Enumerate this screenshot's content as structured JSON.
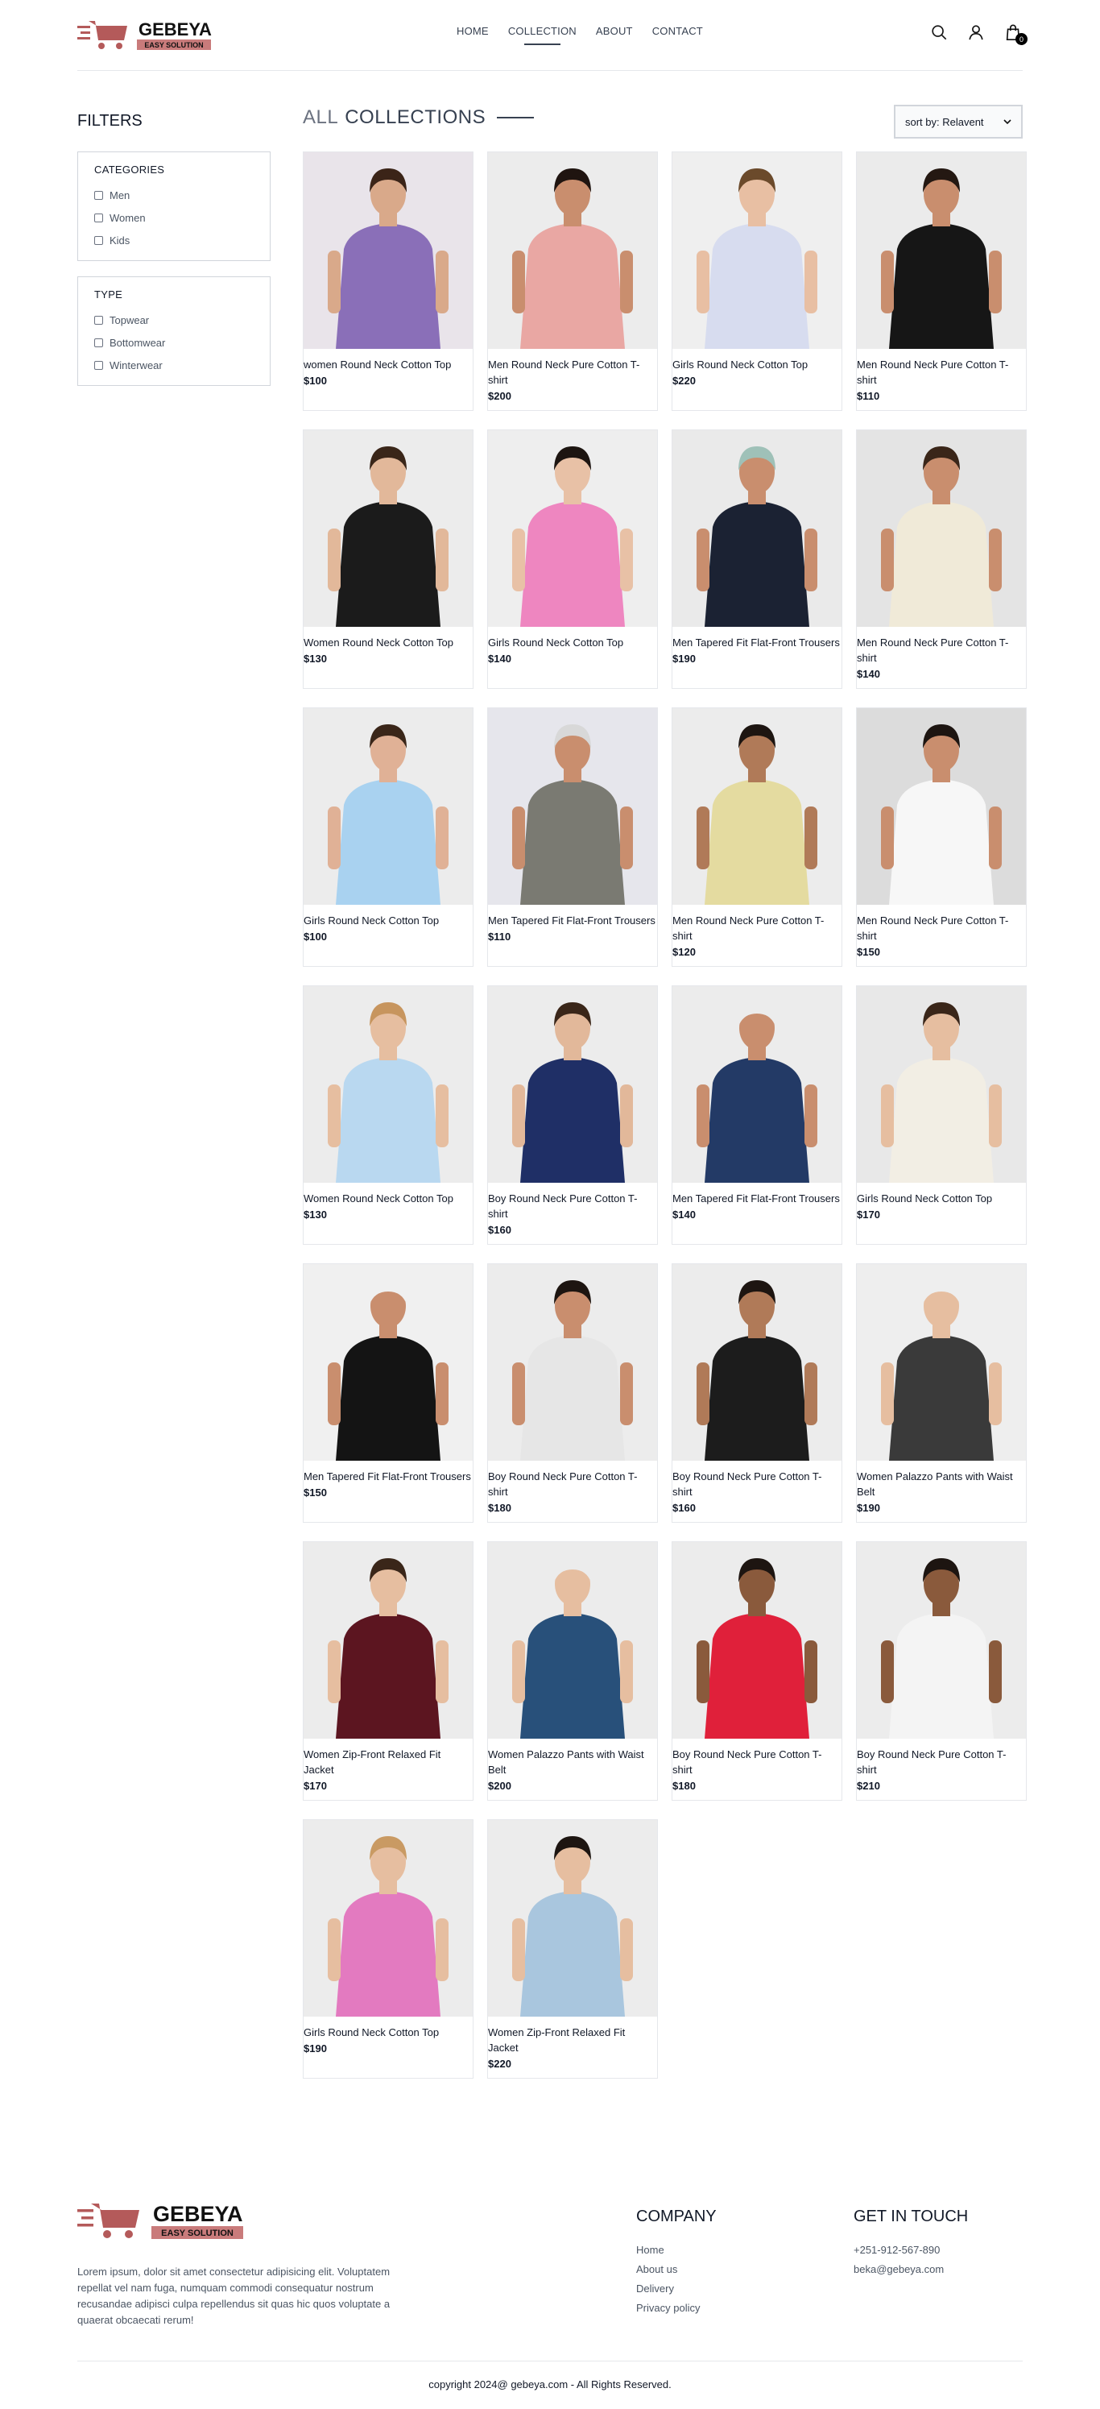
{
  "brand": {
    "name": "GEBEYA",
    "tagline": "EASY SOLUTION",
    "accent": "#b45a5a",
    "tag_bg": "#c97b7b"
  },
  "nav": {
    "items": [
      "HOME",
      "COLLECTION",
      "ABOUT",
      "CONTACT"
    ],
    "active": "COLLECTION"
  },
  "header": {
    "icons": [
      "search-icon",
      "profile-icon",
      "cart-icon"
    ],
    "cart_count": "0"
  },
  "filters": {
    "title": "FILTERS",
    "categories": {
      "title": "CATEGORIES",
      "options": [
        "Men",
        "Women",
        "Kids"
      ]
    },
    "type": {
      "title": "TYPE",
      "options": [
        "Topwear",
        "Bottomwear",
        "Winterwear"
      ]
    }
  },
  "collection": {
    "title_light": "ALL",
    "title_bold": "COLLECTIONS",
    "sort_label": "sort by: Relavent"
  },
  "products": [
    {
      "name": "women Round Neck Cotton Top",
      "price": "$100",
      "bg": "#e9e4ea",
      "cloth": "#8a6fb8",
      "skin": "#d9a98a",
      "hair": "#3b2418"
    },
    {
      "name": "Men Round Neck Pure Cotton T-shirt",
      "price": "$200",
      "bg": "#ececec",
      "cloth": "#e9a7a3",
      "skin": "#c98e6e",
      "hair": "#1f1410"
    },
    {
      "name": "Girls Round Neck Cotton Top",
      "price": "$220",
      "bg": "#efefef",
      "cloth": "#d7dcef",
      "skin": "#e8bfa3",
      "hair": "#6b4a2b"
    },
    {
      "name": "Men Round Neck Pure Cotton T-shirt",
      "price": "$110",
      "bg": "#ebebeb",
      "cloth": "#161616",
      "skin": "#c98e6e",
      "hair": "#241812"
    },
    {
      "name": "Women Round Neck Cotton Top",
      "price": "$130",
      "bg": "#ececec",
      "cloth": "#1b1b1b",
      "skin": "#e2b89a",
      "hair": "#3a2619"
    },
    {
      "name": "Girls Round Neck Cotton Top",
      "price": "$140",
      "bg": "#eeeeee",
      "cloth": "#ee86c0",
      "skin": "#e8c1a6",
      "hair": "#1d1511"
    },
    {
      "name": "Men Tapered Fit Flat-Front Trousers",
      "price": "$190",
      "bg": "#eaeaea",
      "cloth": "#1b2233",
      "skin": "#c98e6e",
      "hair": "#9fc1b8"
    },
    {
      "name": "Men Round Neck Pure Cotton T-shirt",
      "price": "$140",
      "bg": "#e4e4e4",
      "cloth": "#f0ead8",
      "skin": "#c98e6e",
      "hair": "#3a2619"
    },
    {
      "name": "Girls Round Neck Cotton Top",
      "price": "$100",
      "bg": "#ececec",
      "cloth": "#a9d2f0",
      "skin": "#e0b196",
      "hair": "#3a2619"
    },
    {
      "name": "Men Tapered Fit Flat-Front Trousers",
      "price": "$110",
      "bg": "#e6e6ec",
      "cloth": "#7a7a72",
      "skin": "#c98e6e",
      "hair": "#d8d8d8"
    },
    {
      "name": "Men Round Neck Pure Cotton T-shirt",
      "price": "$120",
      "bg": "#ececec",
      "cloth": "#e4dba0",
      "skin": "#b07a58",
      "hair": "#1d1511"
    },
    {
      "name": "Men Round Neck Pure Cotton T-shirt",
      "price": "$150",
      "bg": "#dcdcdc",
      "cloth": "#f7f7f7",
      "skin": "#c98e6e",
      "hair": "#1d1511"
    },
    {
      "name": "Women Round Neck Cotton Top",
      "price": "$130",
      "bg": "#ececec",
      "cloth": "#b9d8f0",
      "skin": "#e6bea0",
      "hair": "#c7955e"
    },
    {
      "name": "Boy Round Neck Pure Cotton T-shirt",
      "price": "$160",
      "bg": "#ececec",
      "cloth": "#1f2f66",
      "skin": "#e2b89a",
      "hair": "#3a2619"
    },
    {
      "name": "Men Tapered Fit Flat-Front Trousers",
      "price": "$140",
      "bg": "#ececec",
      "cloth": "#233a66",
      "skin": "#c98e6e",
      "hair": "#ececec"
    },
    {
      "name": "Girls Round Neck Cotton Top",
      "price": "$170",
      "bg": "#e8e8e8",
      "cloth": "#f2eee4",
      "skin": "#e6bea0",
      "hair": "#3a2619"
    },
    {
      "name": "Men Tapered Fit Flat-Front Trousers",
      "price": "$150",
      "bg": "#f0f0f0",
      "cloth": "#141414",
      "skin": "#c98e6e",
      "hair": "#f0f0f0"
    },
    {
      "name": "Boy Round Neck Pure Cotton T-shirt",
      "price": "$180",
      "bg": "#ececec",
      "cloth": "#e6e6e6",
      "skin": "#c98e6e",
      "hair": "#1d1511"
    },
    {
      "name": "Boy Round Neck Pure Cotton T-shirt",
      "price": "$160",
      "bg": "#ececec",
      "cloth": "#1c1c1c",
      "skin": "#b07a58",
      "hair": "#1d1511"
    },
    {
      "name": "Women Palazzo Pants with Waist Belt",
      "price": "$190",
      "bg": "#eeeeee",
      "cloth": "#3a3a3a",
      "skin": "#e6bea0",
      "hair": "#eeeeee"
    },
    {
      "name": "Women Zip-Front Relaxed Fit Jacket",
      "price": "$170",
      "bg": "#ececec",
      "cloth": "#5c1520",
      "skin": "#e6bea0",
      "hair": "#3a2619"
    },
    {
      "name": "Women Palazzo Pants with Waist Belt",
      "price": "$200",
      "bg": "#ececec",
      "cloth": "#28507a",
      "skin": "#e6bea0",
      "hair": "#ececec"
    },
    {
      "name": "Boy Round Neck Pure Cotton T-shirt",
      "price": "$180",
      "bg": "#ececec",
      "cloth": "#e0203a",
      "skin": "#8a5a3c",
      "hair": "#1d1511"
    },
    {
      "name": "Boy Round Neck Pure Cotton T-shirt",
      "price": "$210",
      "bg": "#ececec",
      "cloth": "#f4f4f4",
      "skin": "#8a5a3c",
      "hair": "#1d1511"
    },
    {
      "name": "Girls Round Neck Cotton Top",
      "price": "$190",
      "bg": "#ececec",
      "cloth": "#e37ac0",
      "skin": "#e6bea0",
      "hair": "#c99a63"
    },
    {
      "name": "Women Zip-Front Relaxed Fit Jacket",
      "price": "$220",
      "bg": "#ececec",
      "cloth": "#a9c6de",
      "skin": "#e6bea0",
      "hair": "#1d1511"
    }
  ],
  "footer": {
    "about": "Lorem ipsum, dolor sit amet consectetur adipisicing elit. Voluptatem repellat vel nam fuga, numquam commodi consequatur nostrum recusandae adipisci culpa repellendus sit quas hic quos voluptate a quaerat obcaecati rerum!",
    "company": {
      "title": "COMPANY",
      "links": [
        "Home",
        "About us",
        "Delivery",
        "Privacy policy"
      ]
    },
    "contact": {
      "title": "GET IN TOUCH",
      "phone": "+251-912-567-890",
      "email": "beka@gebeya.com"
    },
    "copyright": "copyright 2024@ gebeya.com - All Rights Reserved."
  }
}
